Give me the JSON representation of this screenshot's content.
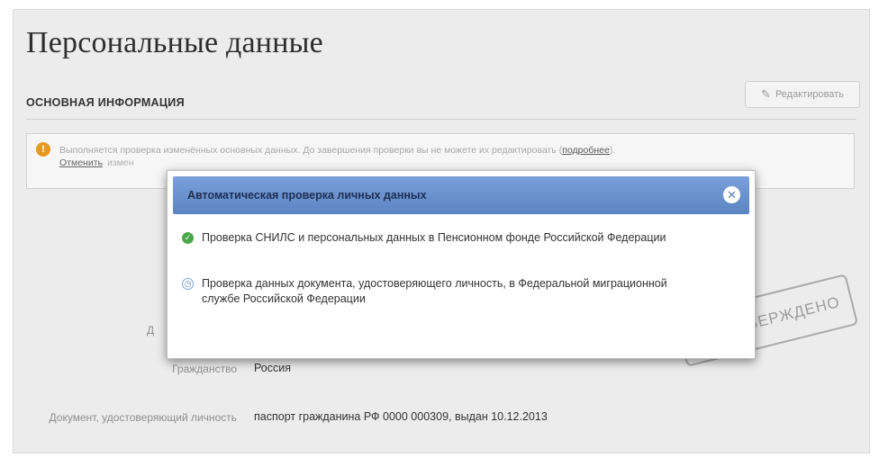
{
  "page": {
    "title": "Персональные данные"
  },
  "section": {
    "title": "ОСНОВНАЯ ИНФОРМАЦИЯ",
    "edit_label": "Редактировать"
  },
  "notice": {
    "text": "Выполняется проверка изменённых основных данных. До завершения проверки вы не можете их редактировать",
    "more_link": "подробнее",
    "cancel_link": "Отменить",
    "cancel_rest": "измен",
    "icon": "warning-icon",
    "icon_glyph": "!",
    "icon_color": "#e59a1f"
  },
  "fields": [
    {
      "label": "Д",
      "value": ""
    },
    {
      "label": "Гражданство",
      "value": "Россия"
    },
    {
      "label": "Документ, удостоверяющий личность",
      "value": "паспорт гражданина РФ 0000 000309, выдан 10.12.2013"
    }
  ],
  "stamp": {
    "text": "ТВЕРЖДЕНО",
    "check_glyph": "✓"
  },
  "modal": {
    "title": "Автоматическая проверка личных данных",
    "close_glyph": "✕",
    "header_color": "#5b84c2",
    "items": [
      {
        "status": "done",
        "icon": "check-icon",
        "glyph": "✓",
        "color": "#4aa64a",
        "text": "Проверка СНИЛС и персональных данных в Пенсионном фонде Российской Федерации"
      },
      {
        "status": "in-progress",
        "icon": "clock-icon",
        "glyph": "◷",
        "color": "#5b84c2",
        "text": "Проверка данных документа, удостоверяющего личность, в Федеральной миграционной службе Российской Федерации"
      }
    ]
  }
}
